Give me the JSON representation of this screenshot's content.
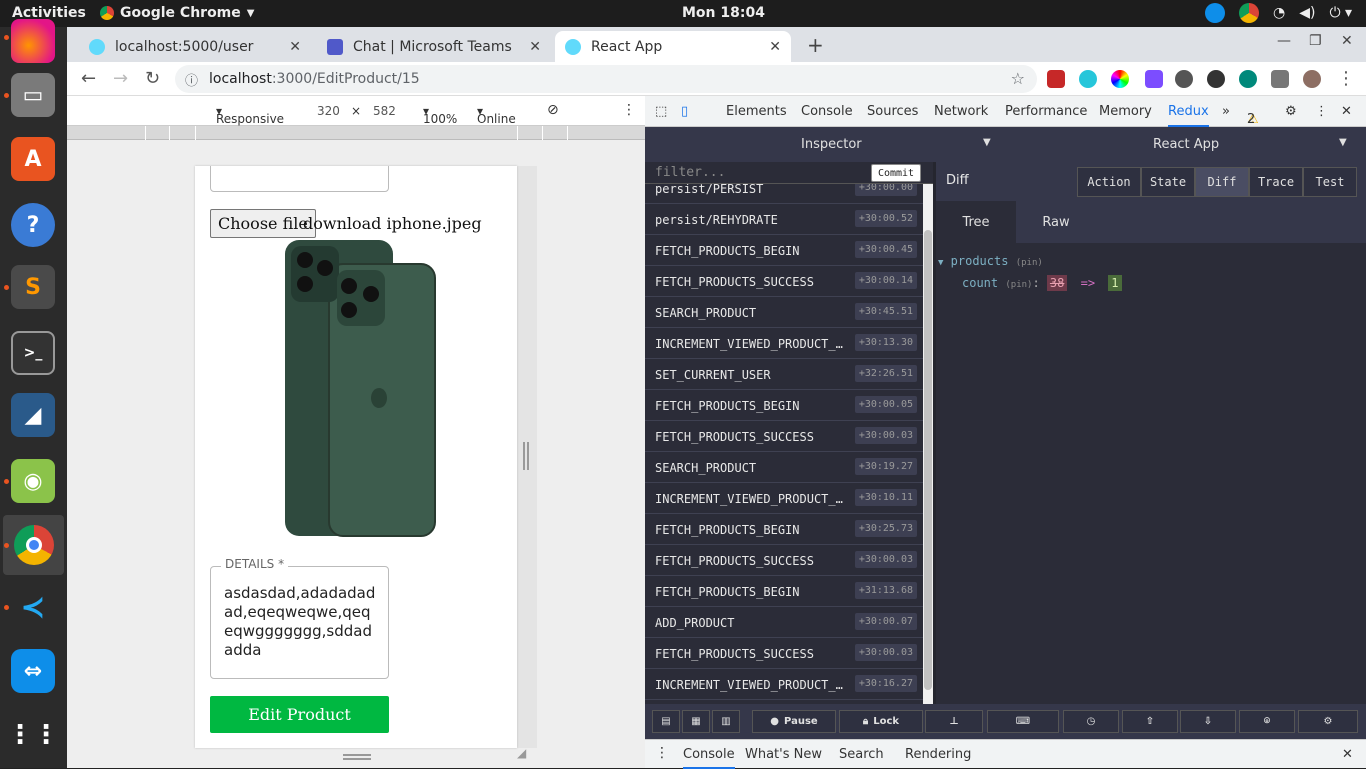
{
  "topbar": {
    "activities": "Activities",
    "app": "Google Chrome",
    "clock": "Mon 18:04"
  },
  "dock": {
    "items": [
      "firefox-icon",
      "files-icon",
      "software-icon",
      "help-icon",
      "sublime-icon",
      "terminal-icon",
      "mysql-workbench-icon",
      "image-viewer-icon",
      "chrome-icon",
      "vscode-icon",
      "teamviewer-icon",
      "app-grid-icon"
    ]
  },
  "tabs": [
    {
      "title": "localhost:5000/user"
    },
    {
      "title": "Chat | Microsoft Teams"
    },
    {
      "title": "React App"
    }
  ],
  "omnibox": {
    "host": "localhost",
    "path": ":3000/EditProduct/15"
  },
  "devicebar": {
    "mode": "Responsive",
    "width": "320",
    "x": "×",
    "height": "582",
    "zoom": "100%",
    "throttle": "Online"
  },
  "page": {
    "choose_file": "Choose file",
    "file_name": "download iphone.jpeg",
    "details_label": "DETAILS *",
    "details_text": "asdasdad,adadadadad,eqeqweqwe,qeqeqwggggggg,sddadadda",
    "edit_button": "Edit Product"
  },
  "devtools": {
    "tabs": [
      "Elements",
      "Console",
      "Sources",
      "Network",
      "Performance",
      "Memory",
      "Redux"
    ],
    "warnings": "2",
    "inspector": "Inspector",
    "app_name": "React App",
    "filter_placeholder": "filter...",
    "commit": "Commit",
    "actions": [
      {
        "name": "persist/PERSIST",
        "time": "+30:00.00"
      },
      {
        "name": "persist/REHYDRATE",
        "time": "+30:00.52"
      },
      {
        "name": "FETCH_PRODUCTS_BEGIN",
        "time": "+30:00.45"
      },
      {
        "name": "FETCH_PRODUCTS_SUCCESS",
        "time": "+30:00.14"
      },
      {
        "name": "SEARCH_PRODUCT",
        "time": "+30:45.51"
      },
      {
        "name": "INCREMENT_VIEWED_PRODUCT_…",
        "time": "+30:13.30"
      },
      {
        "name": "SET_CURRENT_USER",
        "time": "+32:26.51"
      },
      {
        "name": "FETCH_PRODUCTS_BEGIN",
        "time": "+30:00.05"
      },
      {
        "name": "FETCH_PRODUCTS_SUCCESS",
        "time": "+30:00.03"
      },
      {
        "name": "SEARCH_PRODUCT",
        "time": "+30:19.27"
      },
      {
        "name": "INCREMENT_VIEWED_PRODUCT_…",
        "time": "+30:10.11"
      },
      {
        "name": "FETCH_PRODUCTS_BEGIN",
        "time": "+30:25.73"
      },
      {
        "name": "FETCH_PRODUCTS_SUCCESS",
        "time": "+30:00.03"
      },
      {
        "name": "FETCH_PRODUCTS_BEGIN",
        "time": "+31:13.68"
      },
      {
        "name": "ADD_PRODUCT",
        "time": "+30:00.07"
      },
      {
        "name": "FETCH_PRODUCTS_SUCCESS",
        "time": "+30:00.03"
      },
      {
        "name": "INCREMENT_VIEWED_PRODUCT_…",
        "time": "+30:16.27"
      }
    ],
    "diff_label": "Diff",
    "monitor_tabs": [
      "Action",
      "State",
      "Diff",
      "Trace",
      "Test"
    ],
    "sub_tabs": [
      "Tree",
      "Raw"
    ],
    "tree": {
      "root": "products",
      "pin": "(pin)",
      "key": "count",
      "old": "38",
      "arrow": "=>",
      "new": "1"
    },
    "bottom_buttons": {
      "pause": "Pause",
      "lock": "Lock"
    },
    "drawer_tabs": [
      "Console",
      "What's New",
      "Search",
      "Rendering"
    ]
  }
}
